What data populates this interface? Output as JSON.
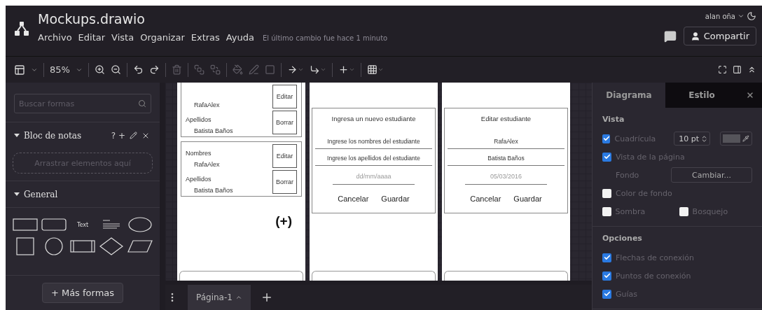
{
  "app": {
    "title": "Mockups.drawio",
    "menu": [
      "Archivo",
      "Editar",
      "Vista",
      "Organizar",
      "Extras",
      "Ayuda"
    ],
    "status": "El último cambio fue hace 1 minuto",
    "user": "alan oña",
    "share_button": "Compartir"
  },
  "toolbar": {
    "zoom": "85%",
    "tool_groups": [
      [
        {
          "kind": "zoom-in",
          "disabled": false
        },
        {
          "kind": "zoom-out",
          "disabled": false
        }
      ],
      [
        {
          "kind": "undo",
          "disabled": false
        },
        {
          "kind": "redo",
          "disabled": false
        }
      ],
      [
        {
          "kind": "delete",
          "disabled": true
        }
      ],
      [
        {
          "kind": "to-front",
          "disabled": true
        },
        {
          "kind": "to-back",
          "disabled": true
        }
      ],
      [
        {
          "kind": "fill",
          "disabled": true
        },
        {
          "kind": "line",
          "disabled": true
        },
        {
          "kind": "shadow",
          "disabled": true
        }
      ],
      [
        {
          "kind": "connection",
          "disabled": false
        },
        {
          "kind": "waypoints",
          "disabled": false
        }
      ],
      [
        {
          "kind": "insert",
          "disabled": false
        }
      ],
      [
        {
          "kind": "table",
          "disabled": false
        }
      ]
    ]
  },
  "sidebar": {
    "search": {
      "placeholder": "Buscar formas"
    },
    "sections": [
      {
        "title": "Bloc de notas",
        "expanded": true,
        "actions": "? +",
        "dropzone": "Arrastrar elementos aquí"
      },
      {
        "title": "General",
        "expanded": true,
        "shapes": [
          {
            "kind": "rect"
          },
          {
            "kind": "rounded"
          },
          {
            "kind": "text",
            "label": "Text"
          },
          {
            "kind": "textbox"
          },
          {
            "kind": "ellipse"
          },
          {
            "kind": "square"
          },
          {
            "kind": "circle"
          },
          {
            "kind": "process"
          },
          {
            "kind": "diamond"
          },
          {
            "kind": "parallelogram"
          }
        ]
      }
    ],
    "more_button": "+ Más formas"
  },
  "mockups": [
    {
      "kind": "list",
      "items": [
        {
          "fields": [
            {
              "value": "RafaAlex",
              "button": "Editar"
            },
            {
              "label": "Apellidos",
              "value": "Batista Baños",
              "button": "Borrar"
            }
          ]
        },
        {
          "fields": [
            {
              "label": "Nombres",
              "value": "RafaAlex",
              "button": "Editar"
            },
            {
              "label": "Apellidos",
              "value": "Batista Baños",
              "button": "Borrar"
            }
          ]
        }
      ],
      "add_button": "(+)"
    },
    {
      "kind": "form",
      "title": "Ingresa un nuevo estudiante",
      "fields": [
        {
          "text": "Ingrese los nombres del estudiante",
          "kind": "line"
        },
        {
          "text": "Ingrese los apellidos del estudiante",
          "kind": "line"
        },
        {
          "text": "dd/mm/aaaa",
          "kind": "date"
        }
      ],
      "buttons": [
        "Cancelar",
        "Guardar"
      ]
    },
    {
      "kind": "form",
      "title": "Editar estudiante",
      "fields": [
        {
          "text": "RafaAlex",
          "kind": "line"
        },
        {
          "text": "Batista Baños",
          "kind": "line"
        },
        {
          "text": "05/03/2016",
          "kind": "date"
        }
      ],
      "buttons": [
        "Cancelar",
        "Guardar"
      ]
    }
  ],
  "pages": [
    {
      "label": "Página-1",
      "selected": true
    }
  ],
  "format_panel": {
    "tabs": [
      {
        "label": "Diagrama",
        "selected": true
      },
      {
        "label": "Estilo",
        "selected": false
      }
    ],
    "sections": [
      {
        "title": "Vista",
        "rows": [
          {
            "kind": "grid",
            "label": "Cuadrícula",
            "checked": true,
            "value": "10 pt"
          },
          {
            "kind": "check",
            "label": "Vista de la página",
            "checked": true
          },
          {
            "kind": "background",
            "label": "Fondo",
            "button": "Cambiar..."
          },
          {
            "kind": "check",
            "label": "Color de fondo",
            "checked": false
          },
          {
            "kind": "pair",
            "items": [
              {
                "label": "Sombra",
                "checked": false
              },
              {
                "label": "Bosquejo",
                "checked": false
              }
            ]
          }
        ]
      },
      {
        "title": "Opciones",
        "rows": [
          {
            "kind": "check",
            "label": "Flechas de conexión",
            "checked": true
          },
          {
            "kind": "check",
            "label": "Puntos de conexión",
            "checked": true
          },
          {
            "kind": "check",
            "label": "Guías",
            "checked": true
          }
        ]
      }
    ]
  }
}
